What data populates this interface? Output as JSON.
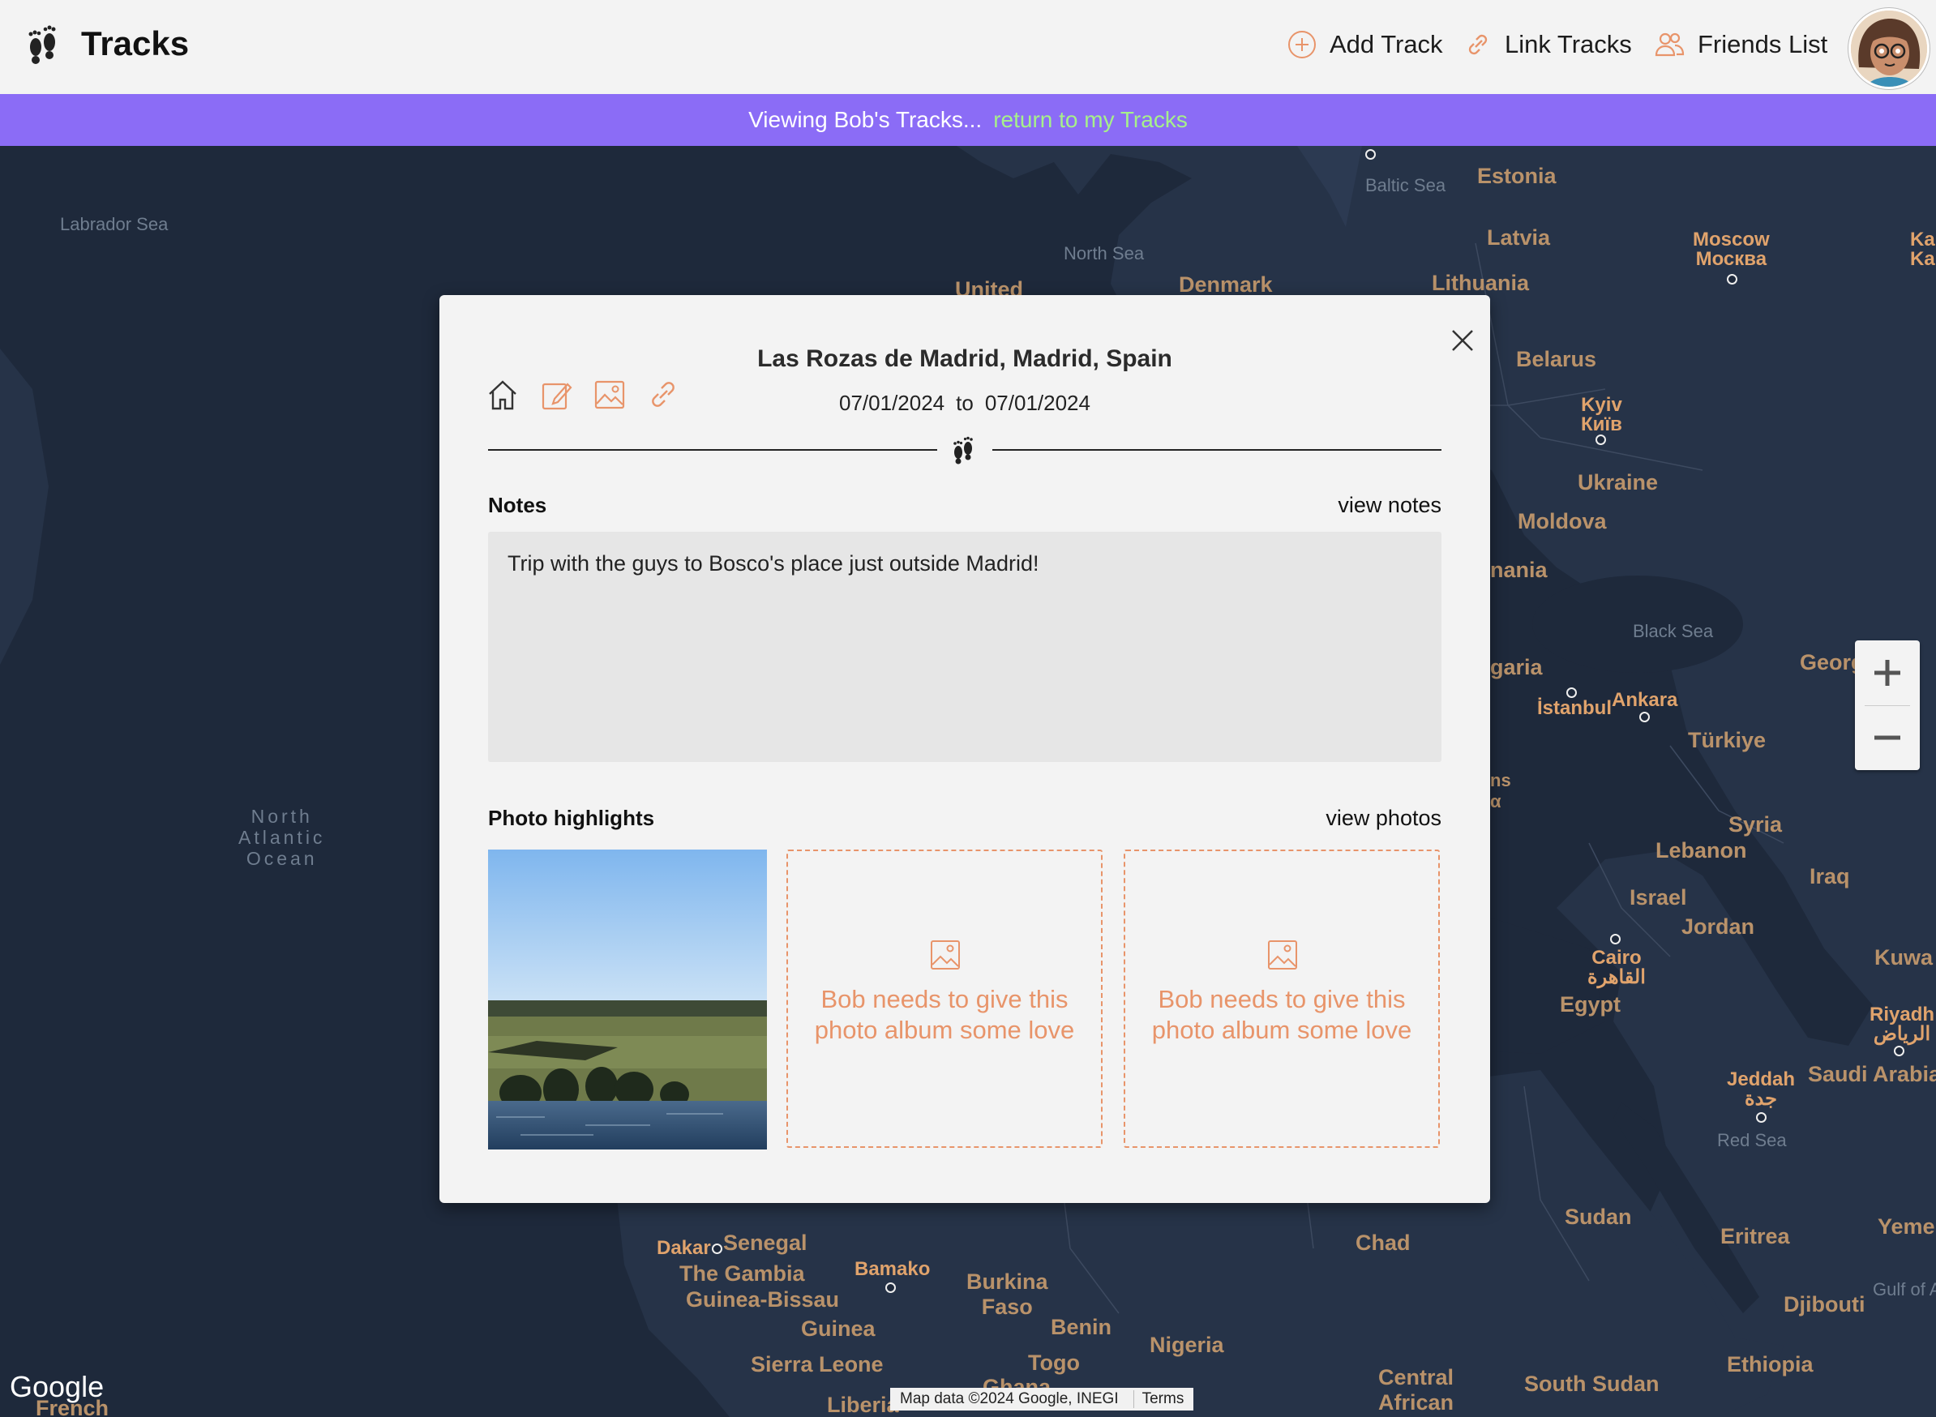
{
  "app": {
    "title": "Tracks"
  },
  "nav": {
    "add_track": "Add Track",
    "link_tracks": "Link Tracks",
    "friends_list": "Friends List"
  },
  "banner": {
    "text": "Viewing Bob's Tracks...",
    "link": "return to my Tracks"
  },
  "map": {
    "labels": {
      "labrador_sea": "Labrador Sea",
      "north_sea": "North Sea",
      "baltic_sea": "Baltic Sea",
      "black_sea": "Black Sea",
      "red_sea": "Red Sea",
      "gulf_of": "Gulf of A",
      "ocean_l1": "North",
      "ocean_l2": "Atlantic",
      "ocean_l3": "Ocean",
      "estonia": "Estonia",
      "latvia": "Latvia",
      "lithuania": "Lithuania",
      "denmark": "Denmark",
      "united": "United",
      "belarus": "Belarus",
      "ukraine": "Ukraine",
      "moldova": "Moldova",
      "romania": "nania",
      "bulgaria": "garia",
      "greece1": "ns",
      "greece2": "α",
      "turkiye": "Türkiye",
      "georgia": "Georg",
      "syria": "Syria",
      "lebanon": "Lebanon",
      "iraq": "Iraq",
      "israel": "Israel",
      "jordan": "Jordan",
      "egypt": "Egypt",
      "kuwait": "Kuwa",
      "saudi": "Saudi Arabia",
      "sudan": "Sudan",
      "eritrea": "Eritrea",
      "yemen": "Yeme",
      "djibouti": "Djibouti",
      "ethiopia": "Ethiopia",
      "south_sudan": "South Sudan",
      "central_african1": "Central",
      "central_african2": "African",
      "chad": "Chad",
      "nigeria": "Nigeria",
      "benin": "Benin",
      "togo": "Togo",
      "ghana": "Ghana",
      "burkina1": "Burkina",
      "burkina2": "Faso",
      "senegal": "Senegal",
      "gambia": "The Gambia",
      "guinea_bissau": "Guinea-Bissau",
      "guinea": "Guinea",
      "sierra_leone": "Sierra Leone",
      "liberia": "Liberia",
      "french": "French",
      "moscow": "Moscow",
      "moscow_ru": "Москва",
      "kyiv": "Kyiv",
      "kyiv_uk": "Київ",
      "istanbul": "İstanbul",
      "ankara": "Ankara",
      "cairo": "Cairo",
      "cairo_ar": "القاهرة",
      "riyadh": "Riyadh",
      "riyadh_ar": "الرياض",
      "jeddah": "Jeddah",
      "jeddah_ar": "جدة",
      "dakar": "Dakar",
      "bamako": "Bamako",
      "kaz1": "Ka",
      "kaz2": "Ka"
    },
    "google": "Google",
    "attribution": "Map data ©2024 Google, INEGI",
    "terms": "Terms"
  },
  "modal": {
    "location": "Las Rozas de Madrid, Madrid, Spain",
    "start_date": "07/01/2024",
    "to": "to",
    "end_date": "07/01/2024",
    "notes_title": "Notes",
    "notes_link": "view notes",
    "notes_text": "Trip with the guys to Bosco's place just outside Madrid!",
    "photos_title": "Photo highlights",
    "photos_link": "view photos",
    "placeholder_text": "Bob needs to give this photo album some love",
    "placeholder_text_2": "Bob needs to give this photo album some love"
  },
  "colors": {
    "accent": "#e8946a",
    "banner": "#8b6cf6",
    "banner_link": "#a6f08a",
    "map_bg": "#1e293b"
  }
}
